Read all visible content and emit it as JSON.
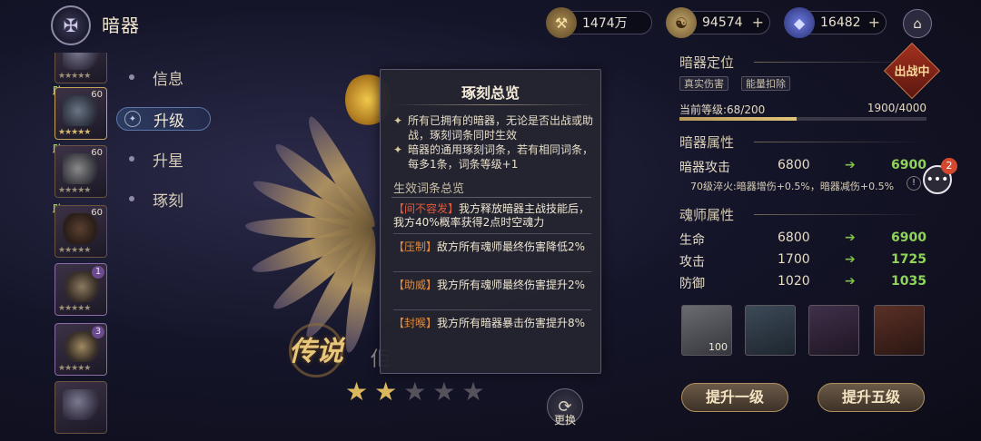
{
  "header": {
    "title": "暗器",
    "emblem_icon": "crossed-blades-icon",
    "currencies": [
      {
        "icon": "gold-ingot-icon",
        "value": "1474万",
        "has_plus": false
      },
      {
        "icon": "spirit-coin-icon",
        "value": "94574",
        "has_plus": true
      },
      {
        "icon": "crystal-icon",
        "value": "16482",
        "has_plus": true
      }
    ],
    "home_icon": "home-icon"
  },
  "item_list": [
    {
      "level": "",
      "assist": "助",
      "stars": 5,
      "count": ""
    },
    {
      "level": "60",
      "assist": "助",
      "stars": 5,
      "count": ""
    },
    {
      "level": "60",
      "assist": "助",
      "stars": 5,
      "count": ""
    },
    {
      "level": "60",
      "assist": "",
      "stars": 5,
      "count": "1"
    },
    {
      "level": "",
      "assist": "",
      "stars": 5,
      "count": "3"
    }
  ],
  "tabs": [
    {
      "label": "信息",
      "active": false
    },
    {
      "label": "升级",
      "active": true
    },
    {
      "label": "升星",
      "active": false
    },
    {
      "label": "琢刻",
      "active": false
    }
  ],
  "artwork": {
    "rarity_label": "传说",
    "name_partial": "佢",
    "stars_total": 5,
    "stars_filled": 2,
    "change_label": "更换"
  },
  "popup": {
    "title": "琢刻总览",
    "bullets": [
      "所有已拥有的暗器，无论是否出战或助战，琢刻词条同时生效",
      "暗器的通用琢刻词条，若有相同词条，每多1条，词条等级+1"
    ],
    "section_title": "生效词条总览",
    "entries": [
      {
        "tag": "【间不容发】",
        "text": "我方释放暗器主战技能后，我方40%概率获得2点时空魂力",
        "color": "#e05a3c"
      },
      {
        "tag": "【压制】",
        "text": "敌方所有魂师最终伤害降低2%",
        "color": "#e05a3c"
      },
      {
        "tag": "【助威】",
        "text": "我方所有魂师最终伤害提升2%",
        "color": "#e05a3c"
      },
      {
        "tag": "【封喉】",
        "text": "我方所有暗器暴击伤害提升8%",
        "color": "#e05a3c"
      }
    ]
  },
  "panel": {
    "positioning_title": "暗器定位",
    "tags": [
      "真实伤害",
      "能量扣除"
    ],
    "deploy_badge": "出战中",
    "level_label": "当前等级:68/200",
    "exp_text": "1900/4000",
    "exp_fraction": 0.475,
    "weapon_attr_title": "暗器属性",
    "weapon_stats": [
      {
        "name": "暗器攻击",
        "old": "6800",
        "new": "6900"
      }
    ],
    "bonus_text": "70级淬火:暗器增伤+0.5%，暗器减伤+0.5%",
    "bonus_info": "!",
    "master_attr_title": "魂师属性",
    "master_stats": [
      {
        "name": "生命",
        "old": "6800",
        "new": "6900"
      },
      {
        "name": "攻击",
        "old": "1700",
        "new": "1725"
      },
      {
        "name": "防御",
        "old": "1020",
        "new": "1035"
      }
    ],
    "materials": [
      {
        "icon": "silver-ingot-icon",
        "count": "100",
        "bg": "#4a4b52"
      },
      {
        "icon": "iron-ingot-icon",
        "count": "",
        "bg": "#2c3540"
      },
      {
        "icon": "dark-ingot-icon",
        "count": "",
        "bg": "#2e2233"
      },
      {
        "icon": "red-ingot-icon",
        "count": "",
        "bg": "#3b2420"
      }
    ],
    "upgrade_one": "提升一级",
    "upgrade_five": "提升五级"
  },
  "chat": {
    "icon": "chat-bubble-icon",
    "badge": "2"
  },
  "colors": {
    "accent_gold": "#c8a45a",
    "stat_up": "#8fd45a",
    "warning_red": "#e05a3c",
    "deploy_red": "#a3301f"
  }
}
